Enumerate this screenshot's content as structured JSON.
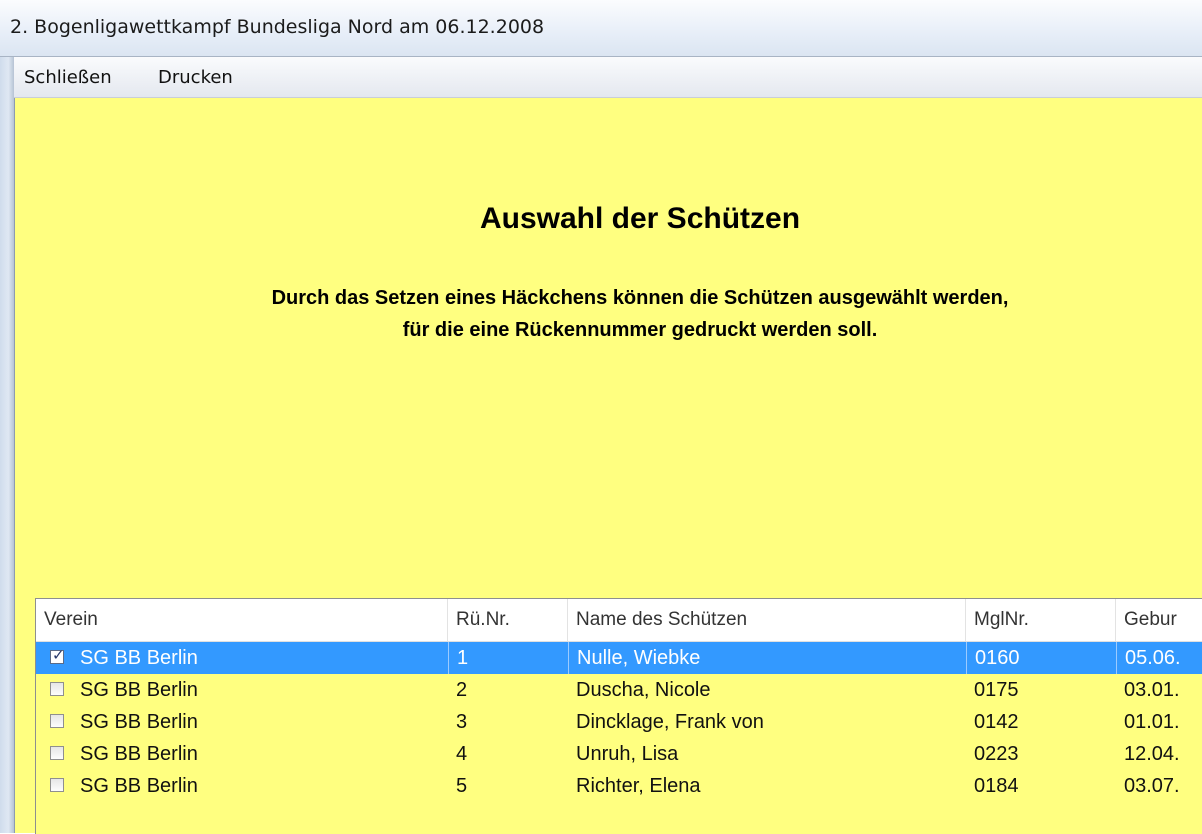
{
  "window": {
    "title": "2. Bogenligawettkampf Bundesliga Nord am 06.12.2008"
  },
  "menu": {
    "close_label": "Schließen",
    "print_label": "Drucken"
  },
  "content": {
    "heading": "Auswahl der Schützen",
    "description_line1": "Durch das Setzen eines Häckchens können die Schützen ausgewählt werden,",
    "description_line2": "für die eine Rückennummer gedruckt werden soll."
  },
  "table": {
    "columns": [
      "Verein",
      "Rü.Nr.",
      "Name des Schützen",
      "MglNr.",
      "Gebur"
    ],
    "rows": [
      {
        "checked": true,
        "verein": "SG BB Berlin",
        "nr": "1",
        "name": "Nulle, Wiebke",
        "mgl": "0160",
        "geb": "05.06."
      },
      {
        "checked": false,
        "verein": "SG BB Berlin",
        "nr": "2",
        "name": "Duscha, Nicole",
        "mgl": "0175",
        "geb": "03.01."
      },
      {
        "checked": false,
        "verein": "SG BB Berlin",
        "nr": "3",
        "name": "Dincklage, Frank von",
        "mgl": "0142",
        "geb": "01.01."
      },
      {
        "checked": false,
        "verein": "SG BB Berlin",
        "nr": "4",
        "name": "Unruh, Lisa",
        "mgl": "0223",
        "geb": "12.04."
      },
      {
        "checked": false,
        "verein": "SG BB Berlin",
        "nr": "5",
        "name": "Richter, Elena",
        "mgl": "0184",
        "geb": "03.07."
      }
    ]
  },
  "colors": {
    "background": "#ffff80",
    "selection": "#3399ff"
  }
}
